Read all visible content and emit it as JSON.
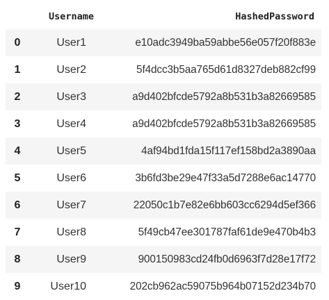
{
  "table": {
    "index_header": "",
    "columns": [
      "Username",
      "HashedPassword"
    ],
    "rows": [
      {
        "index": "0",
        "username": "User1",
        "hash": "e10adc3949ba59abbe56e057f20f883e"
      },
      {
        "index": "1",
        "username": "User2",
        "hash": "5f4dcc3b5aa765d61d8327deb882cf99"
      },
      {
        "index": "2",
        "username": "User3",
        "hash": "a9d402bfcde5792a8b531b3a82669585"
      },
      {
        "index": "3",
        "username": "User4",
        "hash": "a9d402bfcde5792a8b531b3a82669585"
      },
      {
        "index": "4",
        "username": "User5",
        "hash": "4af94bd1fda15f117ef158bd2a3890aa"
      },
      {
        "index": "5",
        "username": "User6",
        "hash": "3b6fd3be29e47f33a5d7288e6ac14770"
      },
      {
        "index": "6",
        "username": "User7",
        "hash": "22050c1b7e82e6bb603cc6294d5ef366"
      },
      {
        "index": "7",
        "username": "User8",
        "hash": "5f49cb47ee301787faf61de9e470b4b3"
      },
      {
        "index": "8",
        "username": "User9",
        "hash": "900150983cd24fb0d6963f7d28e17f72"
      },
      {
        "index": "9",
        "username": "User10",
        "hash": "202cb962ac59075b964b07152d234b70"
      }
    ]
  }
}
